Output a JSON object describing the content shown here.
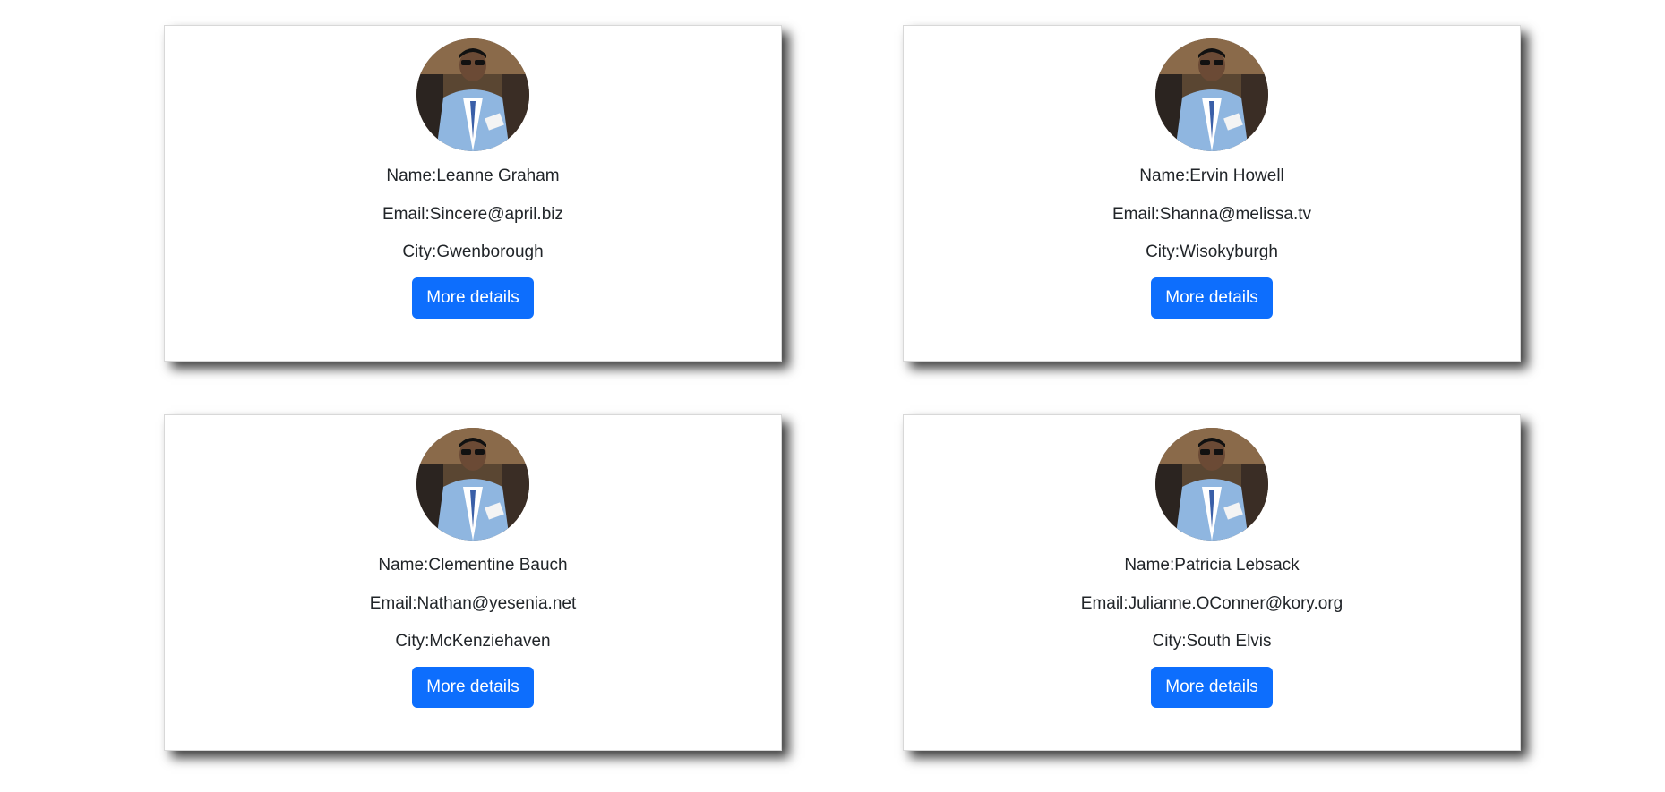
{
  "users": [
    {
      "name_label": "Name:",
      "name": "Leanne Graham",
      "email_label": "Email:",
      "email": "Sincere@april.biz",
      "city_label": "City:",
      "city": "Gwenborough",
      "button": "More details"
    },
    {
      "name_label": "Name:",
      "name": "Ervin Howell",
      "email_label": "Email:",
      "email": "Shanna@melissa.tv",
      "city_label": "City:",
      "city": "Wisokyburgh",
      "button": "More details"
    },
    {
      "name_label": "Name:",
      "name": "Clementine Bauch",
      "email_label": "Email:",
      "email": "Nathan@yesenia.net",
      "city_label": "City:",
      "city": "McKenziehaven",
      "button": "More details"
    },
    {
      "name_label": "Name:",
      "name": "Patricia Lebsack",
      "email_label": "Email:",
      "email": "Julianne.OConner@kory.org",
      "city_label": "City:",
      "city": "South Elvis",
      "button": "More details"
    }
  ],
  "colors": {
    "button_bg": "#0d6efd",
    "button_text": "#ffffff",
    "text": "#212529",
    "card_bg": "#ffffff"
  },
  "icons": {
    "avatar": "user-photo-avatar"
  }
}
